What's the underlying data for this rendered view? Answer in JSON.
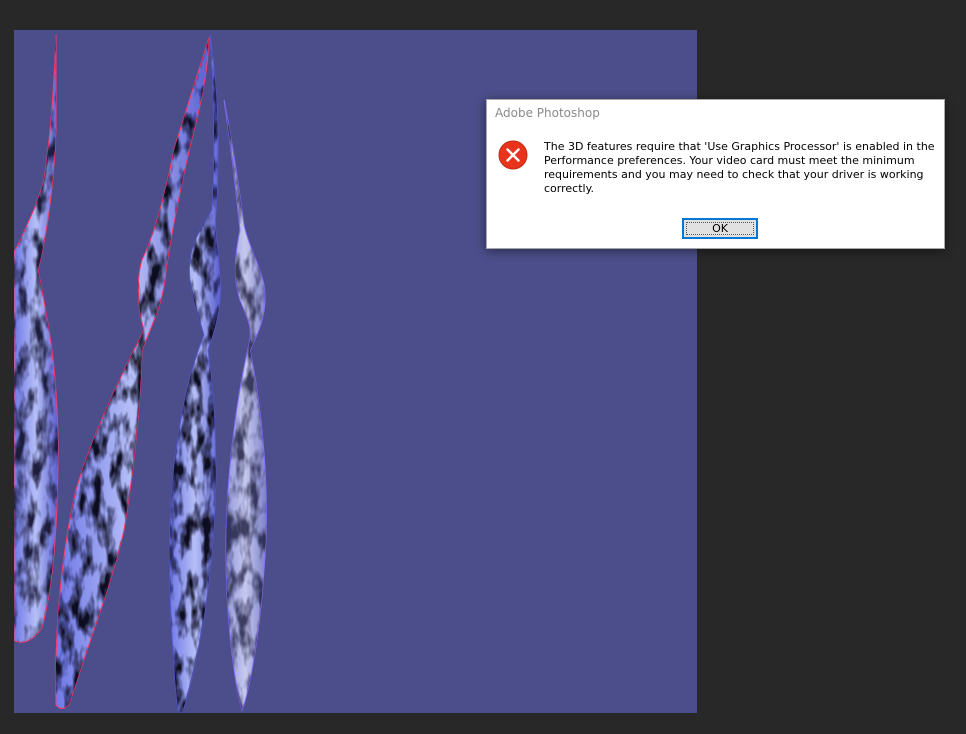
{
  "dialog": {
    "title": "Adobe Photoshop",
    "icon": "error-icon",
    "message": "The 3D features require that 'Use Graphics Processor' is enabled in the Performance preferences. Your video card must meet the minimum requirements and you may need to check that your driver is working correctly.",
    "ok_label": "OK"
  },
  "colors": {
    "workspace_background": "#282828",
    "canvas_background": "#4b4e8a",
    "error_red": "#e8341c",
    "button_focus": "#0078d7"
  }
}
